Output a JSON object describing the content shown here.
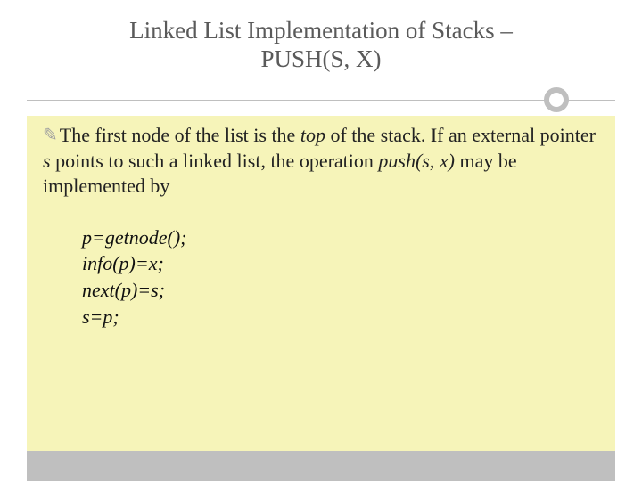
{
  "title_line1": "Linked List Implementation of Stacks –",
  "title_line2": "PUSH(S, X)",
  "bullet": {
    "t1": "The first node of the list is the ",
    "top_word": "top",
    "t2": " of the stack. If an external pointer ",
    "s_word": "s",
    "t3": " points to such a linked list, the operation ",
    "push_word": "push(s, x)",
    "t4": " may be implemented by"
  },
  "code": {
    "l1": "p=getnode();",
    "l2": "info(p)=x;",
    "l3": "next(p)=s;",
    "l4": "s=p;"
  }
}
